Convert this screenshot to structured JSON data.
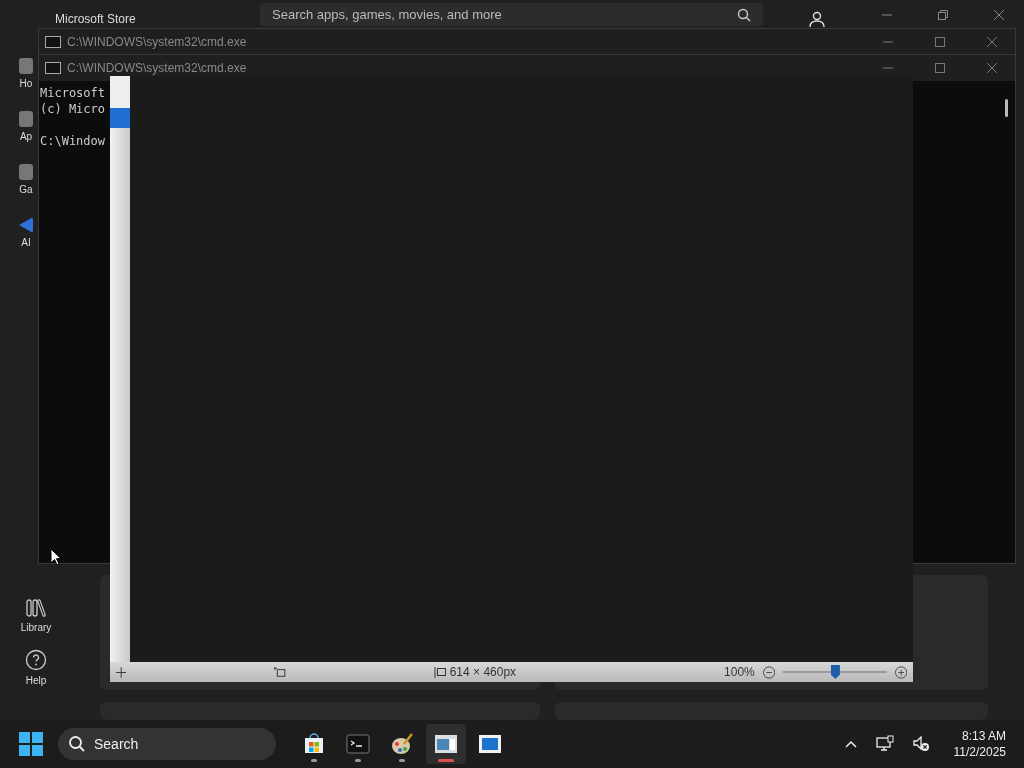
{
  "store": {
    "title": "Microsoft Store",
    "search": {
      "placeholder": "Search apps, games, movies, and more"
    },
    "nav": [
      {
        "label": "Ho",
        "kind": "home"
      },
      {
        "label": "Ap",
        "kind": "apps"
      },
      {
        "label": "Ga",
        "kind": "gaming"
      },
      {
        "label": "AI",
        "kind": "ai"
      }
    ],
    "nav_bottom": [
      {
        "label": "Library",
        "kind": "library"
      },
      {
        "label": "Help",
        "kind": "help"
      }
    ]
  },
  "cmd_windows": [
    {
      "title": "C:\\WINDOWS\\system32\\cmd.exe"
    },
    {
      "title": "C:\\WINDOWS\\system32\\cmd.exe",
      "lines": [
        "Microsoft",
        "(c) Micro",
        "C:\\Window"
      ]
    }
  ],
  "paint": {
    "status": {
      "dimensions": "614 × 460px",
      "zoom": "100%",
      "level": 0.5
    }
  },
  "taskbar": {
    "search": "Search",
    "apps": [
      {
        "kind": "store",
        "running": true,
        "selected": false
      },
      {
        "kind": "terminal",
        "running": true,
        "selected": false
      },
      {
        "kind": "paint",
        "running": true,
        "selected": false
      },
      {
        "kind": "viewer",
        "running": true,
        "selected": true
      },
      {
        "kind": "blue",
        "running": false,
        "selected": false
      }
    ],
    "time": "8:13 AM",
    "date": "11/2/2025"
  }
}
